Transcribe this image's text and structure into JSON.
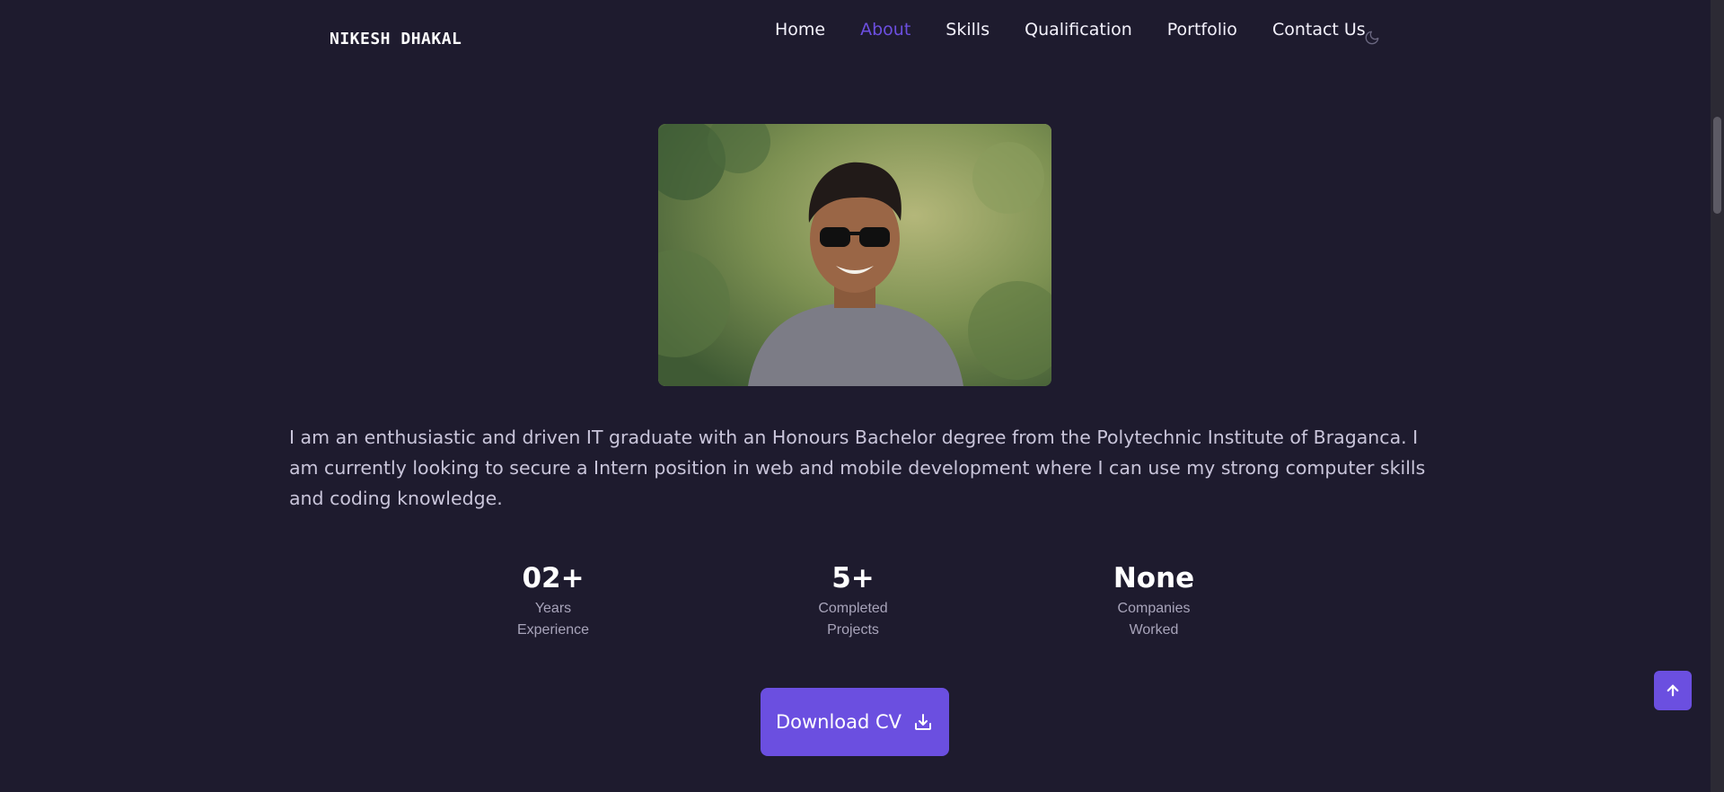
{
  "header": {
    "logo": "NIKESH DHAKAL",
    "nav": [
      {
        "label": "Home",
        "active": false
      },
      {
        "label": "About",
        "active": true
      },
      {
        "label": "Skills",
        "active": false
      },
      {
        "label": "Qualification",
        "active": false
      },
      {
        "label": "Portfolio",
        "active": false
      },
      {
        "label": "Contact Us",
        "active": false
      }
    ],
    "theme_icon": "moon-icon"
  },
  "about": {
    "photo_icon": "profile-photo",
    "description": "I am an enthusiastic and driven IT graduate with an Honours Bachelor degree from the Polytechnic Institute of Braganca. I am currently looking to secure a Intern position in web and mobile development where I can use my strong computer skills and coding knowledge.",
    "stats": [
      {
        "value": "02+",
        "label_line1": "Years",
        "label_line2": "Experience"
      },
      {
        "value": "5+",
        "label_line1": "Completed",
        "label_line2": "Projects"
      },
      {
        "value": "None",
        "label_line1": "Companies",
        "label_line2": "Worked"
      }
    ],
    "download_label": "Download CV",
    "download_icon": "download-icon"
  },
  "scroll_up_icon": "arrow-up-icon",
  "colors": {
    "background": "#1e1b2e",
    "accent": "#6b4fe0",
    "text_primary": "#ffffff",
    "text_secondary": "#c9c5da"
  }
}
